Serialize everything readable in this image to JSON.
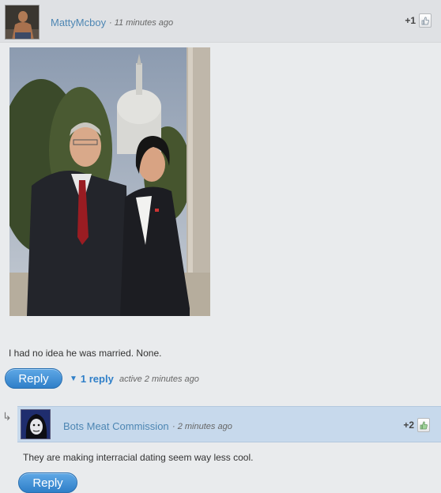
{
  "comment": {
    "username": "MattyMcboy",
    "time": "· 11 minutes ago",
    "votes": "+1",
    "text": "I had no idea he was married. None.",
    "reply_label": "Reply",
    "replies_count": "1 reply",
    "active_meta": "active 2 minutes ago"
  },
  "reply": {
    "username": "Bots Meat Commission",
    "time": "· 2 minutes ago",
    "votes": "+2",
    "text": "They are making interracial dating seem way less cool.",
    "reply_label": "Reply"
  },
  "icons": [
    "thumbs-up-icon",
    "reply-arrow-icon",
    "caret-down-icon"
  ],
  "colors": {
    "link": "#4d86b3",
    "button": "#2f7fc8",
    "reply_header": "#c7d9ec"
  }
}
